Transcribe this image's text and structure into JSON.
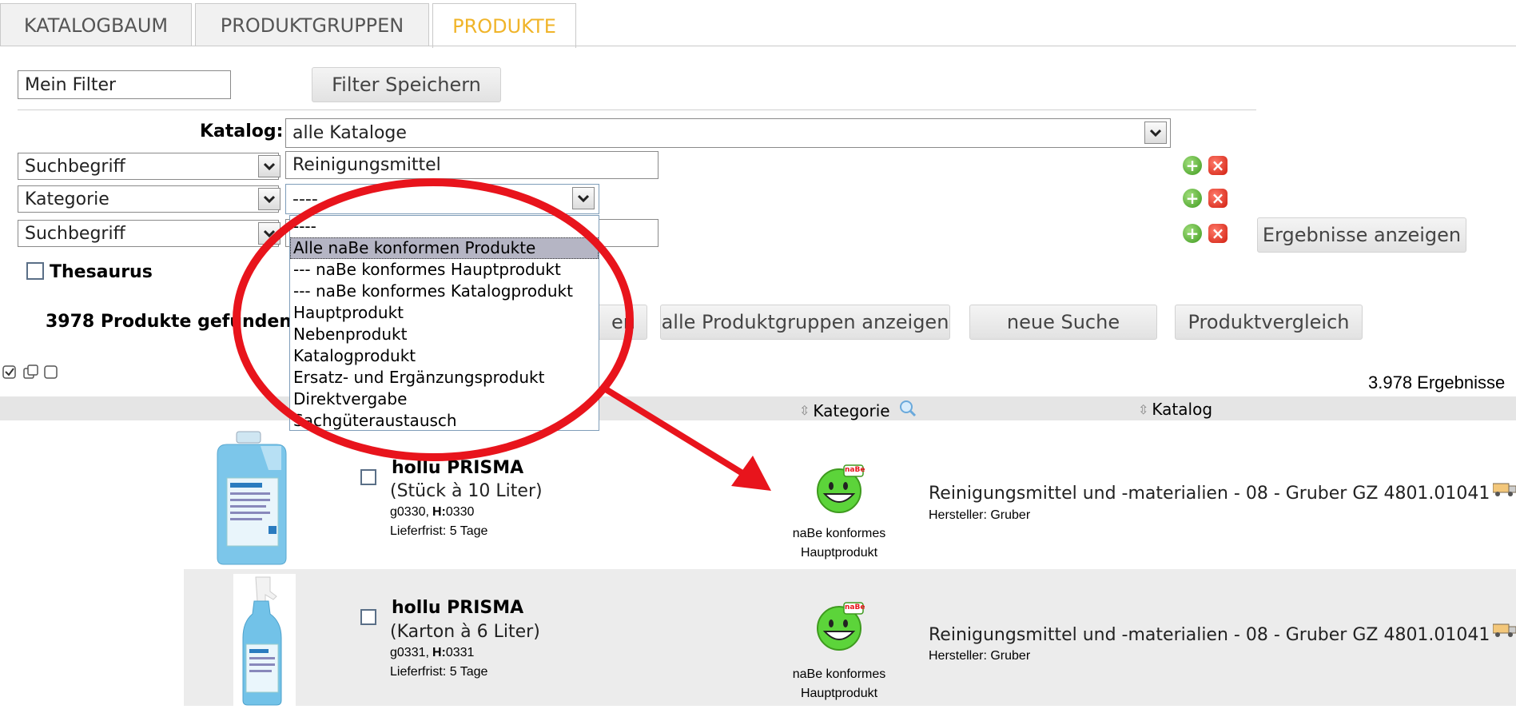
{
  "tabs": [
    {
      "label": "KATALOGBAUM"
    },
    {
      "label": "PRODUKTGRUPPEN"
    },
    {
      "label": "PRODUKTE"
    }
  ],
  "filter": {
    "name_value": "Mein Filter",
    "save_label": "Filter Speichern",
    "catalog_label": "Katalog:",
    "catalog_value": "alle Kataloge",
    "rows": [
      {
        "field": "Suchbegriff",
        "value": "Reinigungsmittel"
      },
      {
        "field": "Kategorie",
        "value": "----"
      },
      {
        "field": "Suchbegriff",
        "value": ""
      }
    ],
    "thesaurus_label": "Thesaurus",
    "show_results_label": "Ergebnisse anzeigen"
  },
  "dropdown": {
    "options": [
      "----",
      "Alle naBe konformen Produkte",
      "--- naBe konformes Hauptprodukt",
      "--- naBe konformes Katalogprodukt",
      "Hauptprodukt",
      "Nebenprodukt",
      "Katalogprodukt",
      "Ersatz- und Ergänzungsprodukt",
      "Direktvergabe",
      "Sachgüteraustausch"
    ],
    "selected_index": 1
  },
  "results": {
    "found_text": "3978 Produkte gefunden",
    "partial_button": "en",
    "all_groups_label": "alle Produktgruppen anzeigen",
    "new_search_label": "neue Suche",
    "compare_label": "Produktvergleich",
    "count_text": "3.978 Ergebnisse",
    "col_category": "Kategorie",
    "col_catalog": "Katalog"
  },
  "products": [
    {
      "name": "hollu PRISMA",
      "pack": "(Stück à 10 Liter)",
      "code": "g0330,",
      "h_label": "H:",
      "h_code": "0330",
      "delivery": "Lieferfrist: 5 Tage",
      "category_line1": "naBe konformes",
      "category_line2": "Hauptprodukt",
      "catalog": "Reinigungsmittel und -materialien - 08 - Gruber GZ 4801.01041",
      "manufacturer": "Hersteller: Gruber"
    },
    {
      "name": "hollu PRISMA",
      "pack": "(Karton à 6 Liter)",
      "code": "g0331,",
      "h_label": "H:",
      "h_code": "0331",
      "delivery": "Lieferfrist: 5 Tage",
      "category_line1": "naBe konformes",
      "category_line2": "Hauptprodukt",
      "catalog": "Reinigungsmittel und -materialien - 08 - Gruber GZ 4801.01041",
      "manufacturer": "Hersteller: Gruber"
    }
  ],
  "badge_text": "naBe",
  "colors": {
    "tab_active": "#f0b429",
    "annotation_red": "#e8141c",
    "smiley_green": "#5cd43a",
    "list_selected": "#b5b5c4"
  }
}
